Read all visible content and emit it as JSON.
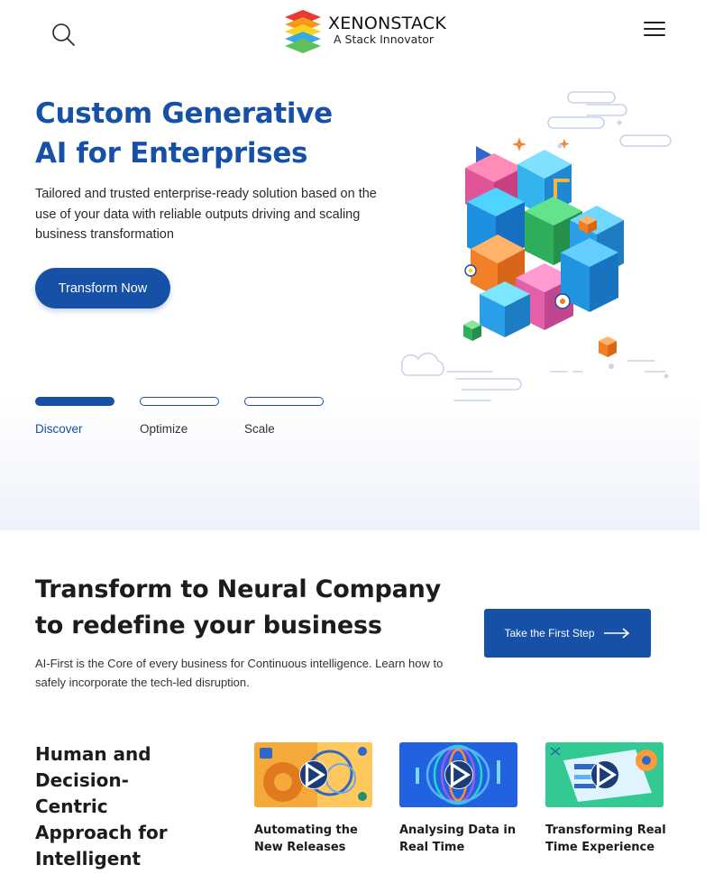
{
  "header": {
    "logo_title": "XENONSTACK",
    "logo_tagline": "A Stack Innovator",
    "icons": {
      "search": "search-icon",
      "menu": "hamburger-menu-icon"
    }
  },
  "hero": {
    "title_line1": "Custom Generative",
    "title_line2": "AI for Enterprises",
    "subtitle": "Tailored and trusted enterprise-ready solution based on the use of your data with reliable outputs driving and scaling business transformation",
    "cta_label": "Transform Now",
    "tabs": [
      {
        "label": "Discover",
        "active": true
      },
      {
        "label": "Optimize",
        "active": false
      },
      {
        "label": "Scale",
        "active": false
      }
    ]
  },
  "neural": {
    "title_line1": "Transform to Neural Company",
    "title_line2": "to redefine your business",
    "text": "AI-First is the Core of every business for Continuous intelligence. Learn how to safely incorporate the tech-led disruption.",
    "cta_label": "Take the First Step"
  },
  "approach": {
    "title_line1": "Human and",
    "title_line2": "Decision-",
    "title_line3": "Centric",
    "title_line4": "Approach for",
    "title_line5": "Intelligent",
    "cards": [
      {
        "title_line1": "Automating the",
        "title_line2": "New Releases"
      },
      {
        "title_line1": "Analysing Data in",
        "title_line2": "Real Time"
      },
      {
        "title_line1": "Transforming Real",
        "title_line2": "Time Experience"
      }
    ]
  },
  "colors": {
    "brand": "#1650a7",
    "heading": "#1c1c1c",
    "hero_bg_fade": "#eef2fb"
  }
}
